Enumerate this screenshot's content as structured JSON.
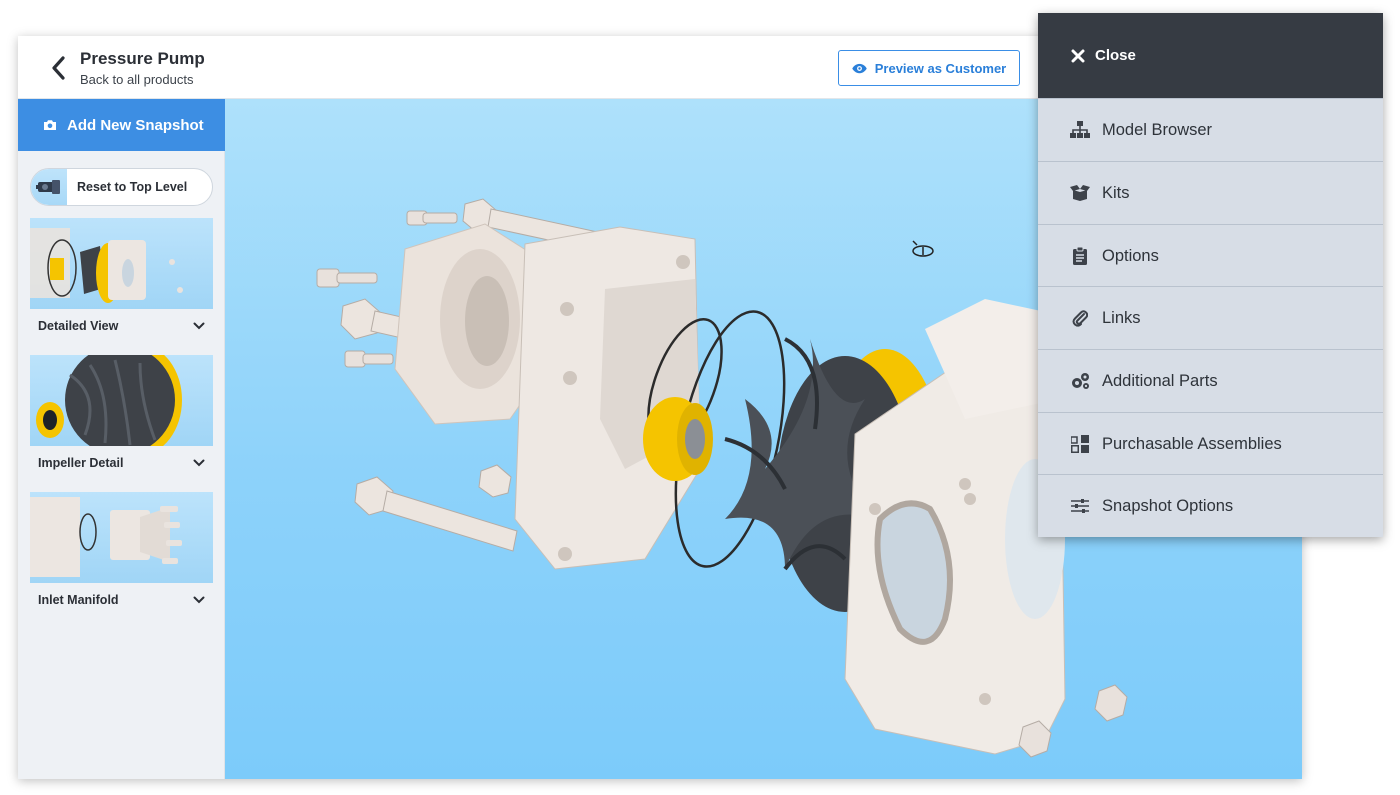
{
  "header": {
    "title": "Pressure Pump",
    "subtitle": "Back to all products",
    "preview_label": "Preview as Customer"
  },
  "sidebar": {
    "add_snapshot_label": "Add New Snapshot",
    "reset_label": "Reset to Top Level",
    "snapshots": [
      {
        "label": "Detailed View"
      },
      {
        "label": "Impeller Detail"
      },
      {
        "label": "Inlet Manifold"
      }
    ]
  },
  "panel": {
    "close_label": "Close",
    "items": [
      {
        "label": "Model Browser",
        "icon": "sitemap-icon"
      },
      {
        "label": "Kits",
        "icon": "box-open-icon"
      },
      {
        "label": "Options",
        "icon": "clipboard-list-icon"
      },
      {
        "label": "Links",
        "icon": "paperclip-icon"
      },
      {
        "label": "Additional Parts",
        "icon": "cogs-icon"
      },
      {
        "label": "Purchasable Assemblies",
        "icon": "cubes-icon"
      },
      {
        "label": "Snapshot Options",
        "icon": "sliders-icon"
      }
    ]
  },
  "colors": {
    "accent": "#3d8ee3",
    "panel_header": "#363b43",
    "panel_bg": "#d7dde6",
    "viewport_top": "#aee1fb",
    "viewport_bottom": "#7ccbfa",
    "part_yellow": "#f5c400",
    "part_dark": "#3e4248",
    "part_light": "#e8e1dc"
  }
}
